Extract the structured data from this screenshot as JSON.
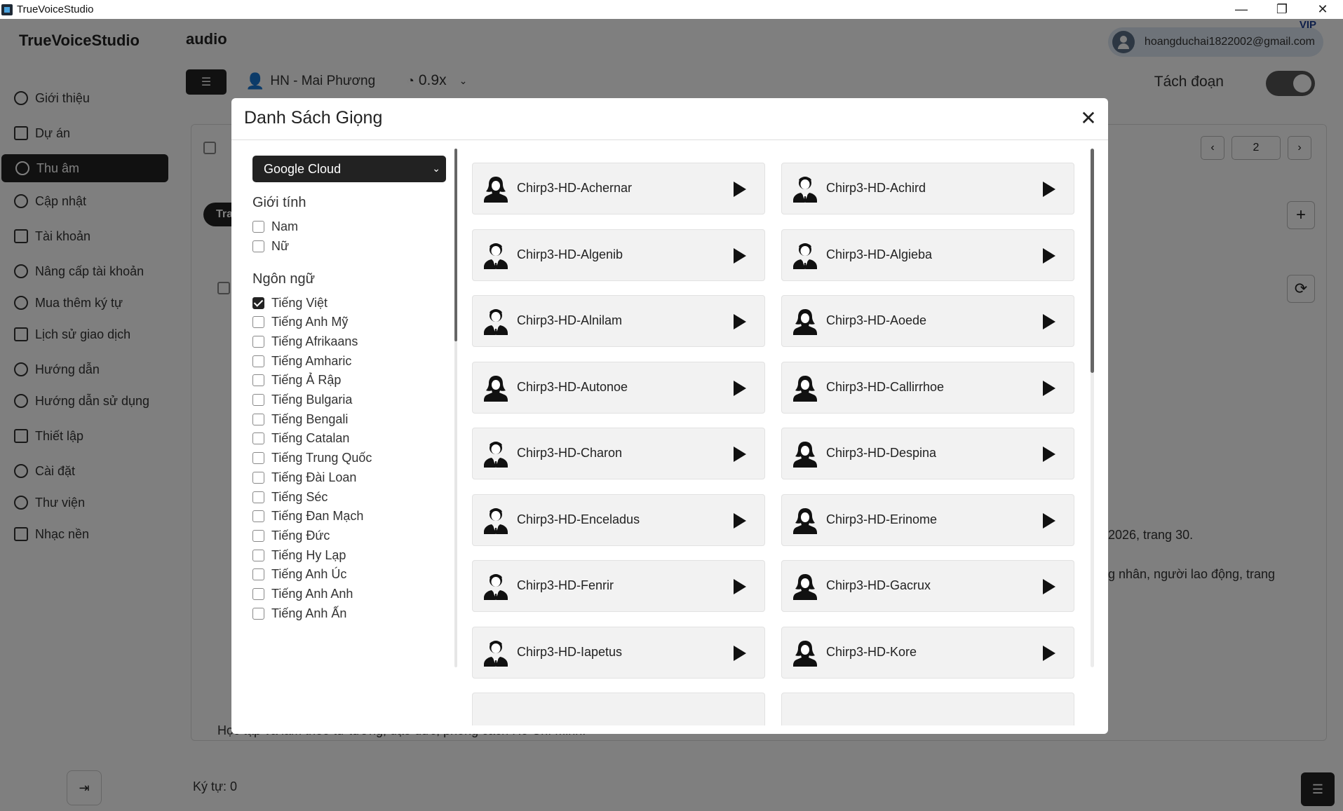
{
  "window": {
    "title": "TrueVoiceStudio",
    "controls": [
      "—",
      "❐",
      "✕"
    ]
  },
  "app": {
    "brand": "TrueVoiceStudio",
    "page_title": "audio",
    "user_email": "hoangduchai1822002@gmail.com",
    "vip_label": "VIP",
    "current_voice": "HN - Mai Phương",
    "speed": "0.9x",
    "split_label": "Tách đoạn",
    "split_enabled": true,
    "page_number": "2",
    "tab_label": "Tra",
    "char_count": "Ký tự: 0",
    "bg_text_1": "2026, trang 30.",
    "bg_text_2": "g nhân, người lao động, trang",
    "bg_text_3": "Học tập và làm theo tư tưởng, đạo đức, phong cách Hồ Chí Minh."
  },
  "sidebar": {
    "items": [
      {
        "label": "Giới thiệu",
        "icon": "info-icon"
      },
      {
        "label": "Dự án",
        "icon": "folder-icon"
      },
      {
        "label": "Thu âm",
        "icon": "file-icon"
      },
      {
        "label": "Cập nhật",
        "icon": "upload-icon"
      },
      {
        "label": "Tài khoản",
        "icon": "account-icon"
      },
      {
        "label": "Nâng cấp tài khoản",
        "icon": "user-upgrade-icon"
      },
      {
        "label": "Mua thêm ký tự",
        "icon": "chart-icon"
      },
      {
        "label": "Lịch sử giao dịch",
        "icon": "history-icon"
      },
      {
        "label": "Hướng dẫn",
        "icon": "guide-icon"
      },
      {
        "label": "Hướng dẫn sử dụng",
        "icon": "manual-icon"
      },
      {
        "label": "Thiết lập",
        "icon": "setup-icon"
      },
      {
        "label": "Cài đặt",
        "icon": "gear-icon"
      },
      {
        "label": "Thư viện",
        "icon": "library-icon"
      },
      {
        "label": "Nhạc nền",
        "icon": "music-icon"
      }
    ],
    "active_index": 2
  },
  "modal": {
    "title": "Danh Sách Giọng",
    "provider": "Google Cloud",
    "gender_heading": "Giới tính",
    "genders": [
      {
        "label": "Nam",
        "checked": false
      },
      {
        "label": "Nữ",
        "checked": false
      }
    ],
    "language_heading": "Ngôn ngữ",
    "languages": [
      {
        "label": "Tiếng Việt",
        "checked": true
      },
      {
        "label": "Tiếng Anh Mỹ",
        "checked": false
      },
      {
        "label": "Tiếng Afrikaans",
        "checked": false
      },
      {
        "label": "Tiếng Amharic",
        "checked": false
      },
      {
        "label": "Tiếng Ả Rập",
        "checked": false
      },
      {
        "label": "Tiếng Bulgaria",
        "checked": false
      },
      {
        "label": "Tiếng Bengali",
        "checked": false
      },
      {
        "label": "Tiếng Catalan",
        "checked": false
      },
      {
        "label": "Tiếng Trung Quốc",
        "checked": false
      },
      {
        "label": "Tiếng Đài Loan",
        "checked": false
      },
      {
        "label": "Tiếng Séc",
        "checked": false
      },
      {
        "label": "Tiếng Đan Mạch",
        "checked": false
      },
      {
        "label": "Tiếng Đức",
        "checked": false
      },
      {
        "label": "Tiếng Hy Lạp",
        "checked": false
      },
      {
        "label": "Tiếng Anh Úc",
        "checked": false
      },
      {
        "label": "Tiếng Anh Anh",
        "checked": false
      },
      {
        "label": "Tiếng Anh Ấn",
        "checked": false
      }
    ],
    "voices": [
      {
        "name": "Chirp3-HD-Achernar",
        "gender": "female"
      },
      {
        "name": "Chirp3-HD-Achird",
        "gender": "male"
      },
      {
        "name": "Chirp3-HD-Algenib",
        "gender": "male"
      },
      {
        "name": "Chirp3-HD-Algieba",
        "gender": "male"
      },
      {
        "name": "Chirp3-HD-Alnilam",
        "gender": "male"
      },
      {
        "name": "Chirp3-HD-Aoede",
        "gender": "female"
      },
      {
        "name": "Chirp3-HD-Autonoe",
        "gender": "female"
      },
      {
        "name": "Chirp3-HD-Callirrhoe",
        "gender": "female"
      },
      {
        "name": "Chirp3-HD-Charon",
        "gender": "male"
      },
      {
        "name": "Chirp3-HD-Despina",
        "gender": "female"
      },
      {
        "name": "Chirp3-HD-Enceladus",
        "gender": "male"
      },
      {
        "name": "Chirp3-HD-Erinome",
        "gender": "female"
      },
      {
        "name": "Chirp3-HD-Fenrir",
        "gender": "male"
      },
      {
        "name": "Chirp3-HD-Gacrux",
        "gender": "female"
      },
      {
        "name": "Chirp3-HD-Iapetus",
        "gender": "male"
      },
      {
        "name": "Chirp3-HD-Kore",
        "gender": "female"
      }
    ]
  }
}
